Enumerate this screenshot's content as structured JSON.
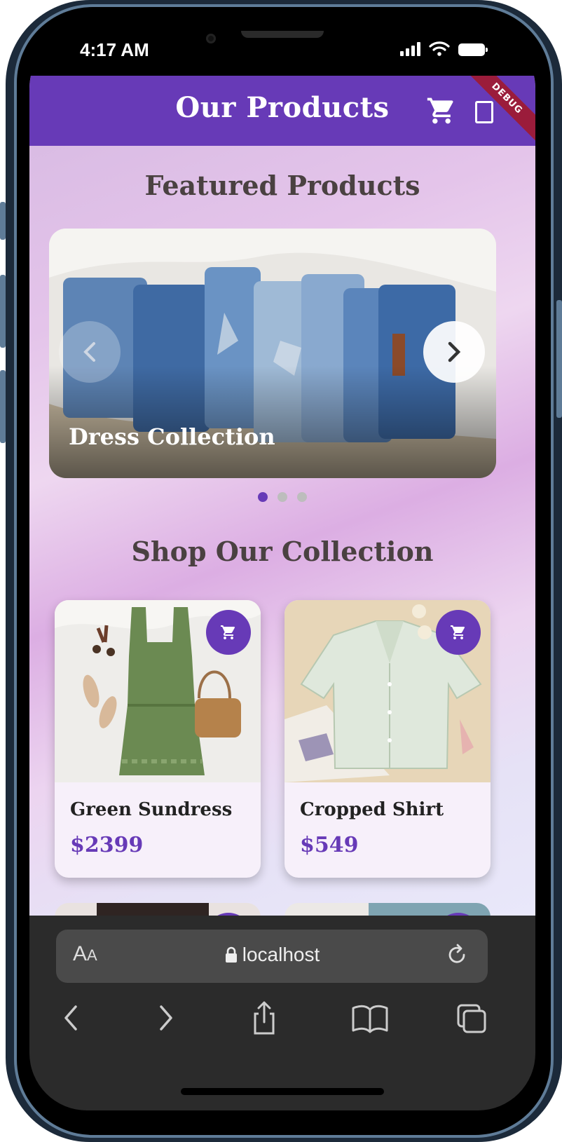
{
  "status_bar": {
    "time": "4:17 AM",
    "icons": [
      "signal-icon",
      "wifi-icon",
      "battery-icon"
    ]
  },
  "app_bar": {
    "title": "Our Products",
    "actions": [
      "cart-icon",
      "document-icon"
    ],
    "debug_banner": "DEBUG",
    "color": "#673ab7"
  },
  "featured": {
    "heading": "Featured Products",
    "slide_caption": "Dress Collection",
    "slide_count": 3,
    "active_slide": 1,
    "controls": [
      "chevron-left-icon",
      "chevron-right-icon"
    ]
  },
  "collection": {
    "heading": "Shop Our Collection",
    "products": [
      {
        "name": "Green Sundress",
        "price": "$2399",
        "action": "add-to-cart-icon"
      },
      {
        "name": "Cropped Shirt",
        "price": "$549",
        "action": "add-to-cart-icon"
      }
    ],
    "price_color": "#673ab7"
  },
  "browser": {
    "text_size_label_big": "A",
    "text_size_label_small": "A",
    "url": "localhost",
    "toolbar": [
      "back-icon",
      "forward-icon",
      "share-icon",
      "bookmarks-icon",
      "tabs-icon"
    ]
  }
}
